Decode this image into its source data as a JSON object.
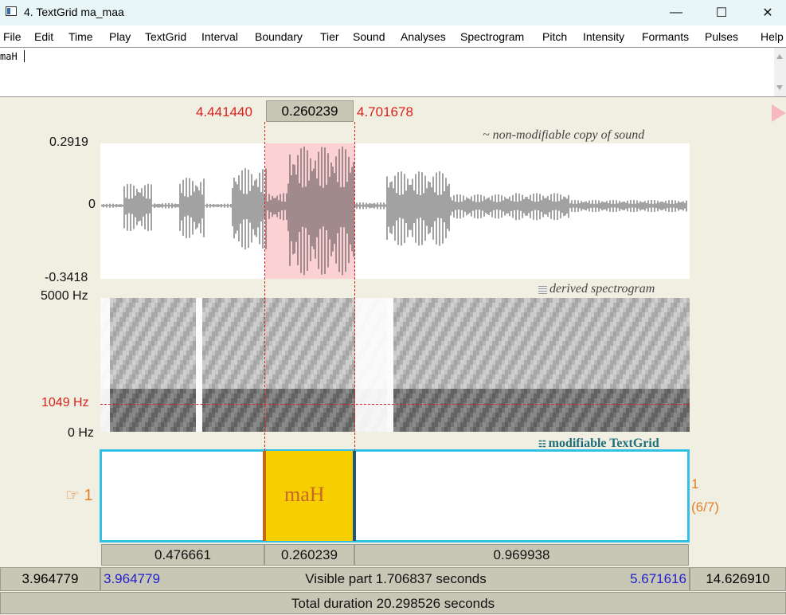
{
  "window": {
    "title": "4. TextGrid ma_maa",
    "minimize_symbol": "—",
    "maximize_symbol": "☐",
    "close_symbol": "✕"
  },
  "menu": [
    "File",
    "Edit",
    "Time",
    "Play",
    "TextGrid",
    "Interval",
    "Boundary",
    "Tier",
    "Sound",
    "Analyses",
    "Spectrogram",
    "Pitch",
    "Intensity",
    "Formants",
    "Pulses",
    "Help"
  ],
  "text_field": {
    "value": "maH"
  },
  "selection": {
    "start": "4.441440",
    "duration": "0.260239",
    "end": "4.701678"
  },
  "sound": {
    "ymax": "0.2919",
    "yzero": "0",
    "ymin": "-0.3418",
    "label": "~ non-modifiable copy of sound"
  },
  "spectrogram": {
    "top": "5000 Hz",
    "cursor_freq": "1049 Hz",
    "bottom": "0 Hz",
    "label": "derived spectrogram"
  },
  "textgrid": {
    "label": "modifiable TextGrid",
    "tier_pointer": "☞ 1",
    "tier_number": "1",
    "tier_count": "(6/7)",
    "interval_text": "maH",
    "intervals": [
      "0.476661",
      "0.260239",
      "0.969938"
    ]
  },
  "visible": {
    "left_outside": "3.964779",
    "start": "3.964779",
    "label": "Visible part 1.706837 seconds",
    "end": "5.671616",
    "right_outside": "14.626910"
  },
  "total": "Total duration 20.298526 seconds",
  "colors": {
    "selection_highlight": "#fcd1d4",
    "interval_highlight": "#f7cf00",
    "tier_border": "#32c0e6",
    "cursor": "#d9221d"
  }
}
